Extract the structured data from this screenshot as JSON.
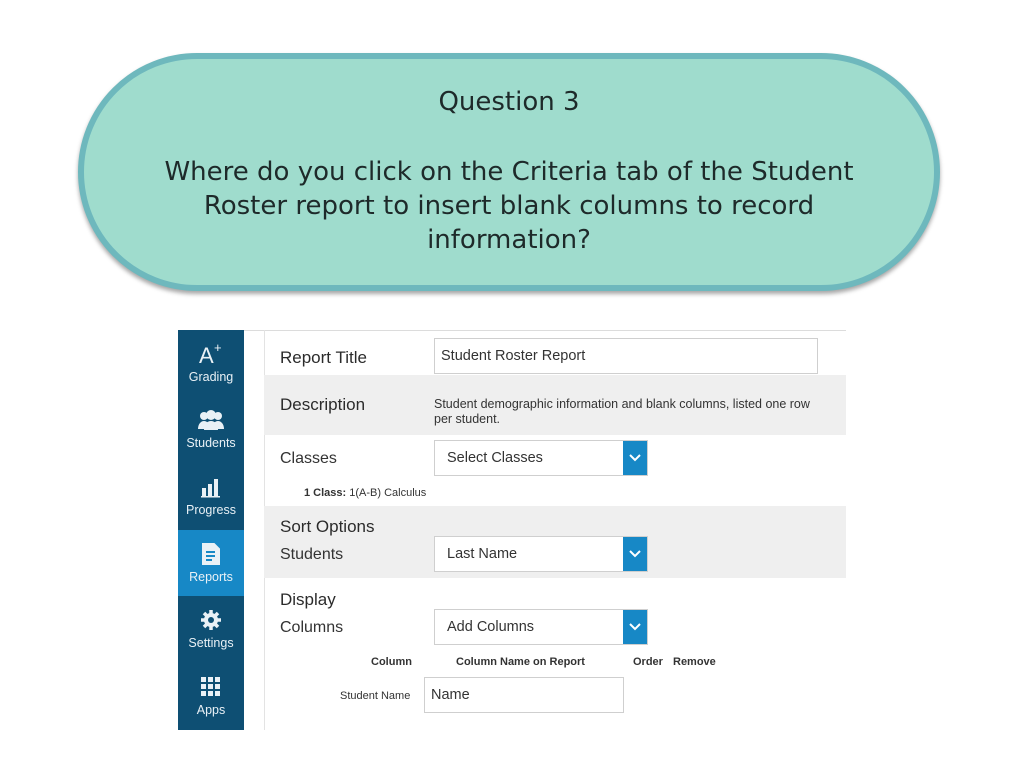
{
  "question": {
    "title": "Question 3",
    "body": "Where do you click on the Criteria tab of the Student Roster report to insert blank columns to record information?"
  },
  "sidebar": {
    "items": [
      {
        "label": "Grading",
        "icon": "grade-a-plus-icon"
      },
      {
        "label": "Students",
        "icon": "people-icon"
      },
      {
        "label": "Progress",
        "icon": "bar-chart-icon"
      },
      {
        "label": "Reports",
        "icon": "report-document-icon",
        "active": true
      },
      {
        "label": "Settings",
        "icon": "gear-icon"
      },
      {
        "label": "Apps",
        "icon": "grid-icon"
      }
    ]
  },
  "form": {
    "report_title_label": "Report Title",
    "report_title_value": "Student Roster Report",
    "description_label": "Description",
    "description_value": "Student demographic information and blank columns, listed one row per student.",
    "classes_label": "Classes",
    "classes_select": "Select Classes",
    "class_count_label": "1 Class:",
    "class_name": "1(A-B) Calculus",
    "sort_options_label": "Sort Options",
    "students_label": "Students",
    "students_select": "Last Name",
    "display_label": "Display",
    "columns_label": "Columns",
    "columns_select": "Add Columns",
    "col_header_column": "Column",
    "col_header_name": "Column Name on Report",
    "col_header_order": "Order",
    "col_header_remove": "Remove",
    "student_name_label": "Student Name",
    "student_name_value": "Name"
  },
  "colors": {
    "sidebar": "#0e4f73",
    "active": "#1788c6",
    "pill_fill": "#9fdccd",
    "pill_border": "#6eb8bd"
  }
}
